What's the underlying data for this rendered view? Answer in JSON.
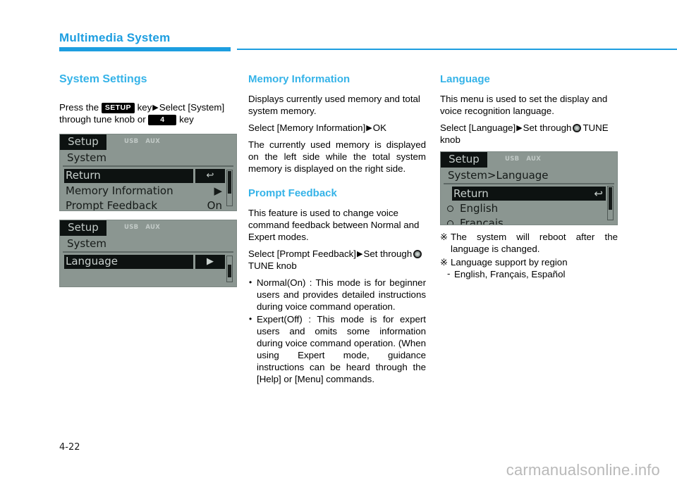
{
  "header": {
    "chapter_title": "Multimedia System"
  },
  "page": {
    "number": "4-22",
    "watermark": "carmanualsonline.info"
  },
  "colors": {
    "accent_blue": "#1d9ee0",
    "heading_blue": "#35b3e8",
    "screen_bg": "#8b9691",
    "screen_dark": "#0d1211"
  },
  "left_column": {
    "heading": "System Settings",
    "instruction": {
      "press_the": "Press the",
      "setup_key": "SETUP",
      "key_word": "key",
      "select_system": "Select [System]",
      "through_tune": "through tune knob or",
      "num_key": "4",
      "key_word2": "key"
    },
    "screen1": {
      "tab": "Setup",
      "sources": [
        "USB",
        "AUX"
      ],
      "breadcrumb": "System",
      "rows": [
        {
          "label": "Return",
          "value": "↩",
          "selected": true,
          "split": true
        },
        {
          "label": "Memory Information",
          "value": "▶",
          "selected": false
        },
        {
          "label": "Prompt Feedback",
          "value": "On",
          "selected": false
        }
      ]
    },
    "screen2": {
      "tab": "Setup",
      "sources": [
        "USB",
        "AUX"
      ],
      "breadcrumb": "System",
      "rows": [
        {
          "label": "Language",
          "value": "▶",
          "selected": true,
          "split": true
        }
      ]
    }
  },
  "middle_column": {
    "memory": {
      "heading": "Memory Information",
      "para1": "Displays currently used memory and total system memory.",
      "select_line_prefix": "Select [Memory Information]",
      "select_line_suffix": "OK",
      "para2": "The currently used memory is displayed on the left side while the total system memory is displayed on the right side."
    },
    "prompt": {
      "heading": "Prompt Feedback",
      "para1": "This feature is used to change voice command feedback between Normal and Expert modes.",
      "select_prefix": "Select    [Prompt    Feedback]",
      "select_mid": "Set through",
      "select_suffix": "TUNE knob",
      "bullets": [
        "Normal(On)  :  This  mode  is  for  beginner  users  and  provides  detailed  instructions  during  voice command operation.",
        "Expert(Off) : This mode is for expert users  and  omits  some  information during  voice  command  operation. (When  using  Expert  mode,  guidance  instructions  can  be  heard through the [Help] or [Menu] commands."
      ]
    }
  },
  "right_column": {
    "language": {
      "heading": "Language",
      "para1": "This menu is used to set the display and voice recognition language.",
      "select_prefix": "Select [Language]",
      "select_mid": "Set through",
      "select_suffix": "TUNE",
      "select_tail": "knob"
    },
    "screen3": {
      "tab": "Setup",
      "sources": [
        "USB",
        "AUX"
      ],
      "breadcrumb": "System>Language",
      "rows": [
        {
          "label": "Return",
          "value": "↩",
          "selected": true,
          "radio": "none"
        },
        {
          "label": "English",
          "value": "",
          "selected": false,
          "radio": "on"
        },
        {
          "label": "Français",
          "value": "",
          "selected": false,
          "radio": "off"
        }
      ]
    },
    "notes": [
      {
        "text": "The  system  will  reboot  after  the language is changed.",
        "sub": ""
      },
      {
        "text": "Language support by region",
        "sub": "English, Français, Español"
      }
    ]
  }
}
